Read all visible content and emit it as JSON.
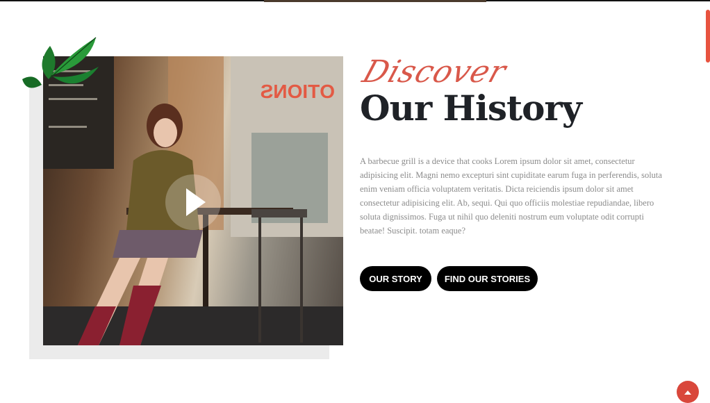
{
  "section": {
    "script_title": "Discover",
    "title": "Our History",
    "description": "A barbecue grill is a device that cooks Lorem ipsum dolor sit amet, consectetur adipisicing elit. Magni nemo excepturi sint cupiditate earum fuga in perferendis, soluta enim veniam officia voluptatem veritatis. Dicta reiciendis ipsum dolor sit amet consectetur adipisicing elit. Ab, sequi. Qui quo officiis molestiae repudiandae, libero soluta dignissimos. Fuga ut nihil quo deleniti nostrum eum voluptate odit corrupti beatae! Suscipit. totam eaque?"
  },
  "buttons": {
    "our_story": "OUR STORY",
    "find_stories": "FIND OUR STORIES"
  },
  "media": {
    "play_icon": "play-icon",
    "decor_icon": "mint-leaves-icon"
  },
  "controls": {
    "back_to_top_icon": "arrow-up-icon"
  },
  "colors": {
    "accent": "#d9584a",
    "button_bg": "#000000",
    "title": "#1f2227",
    "text": "#8b8b8b"
  }
}
